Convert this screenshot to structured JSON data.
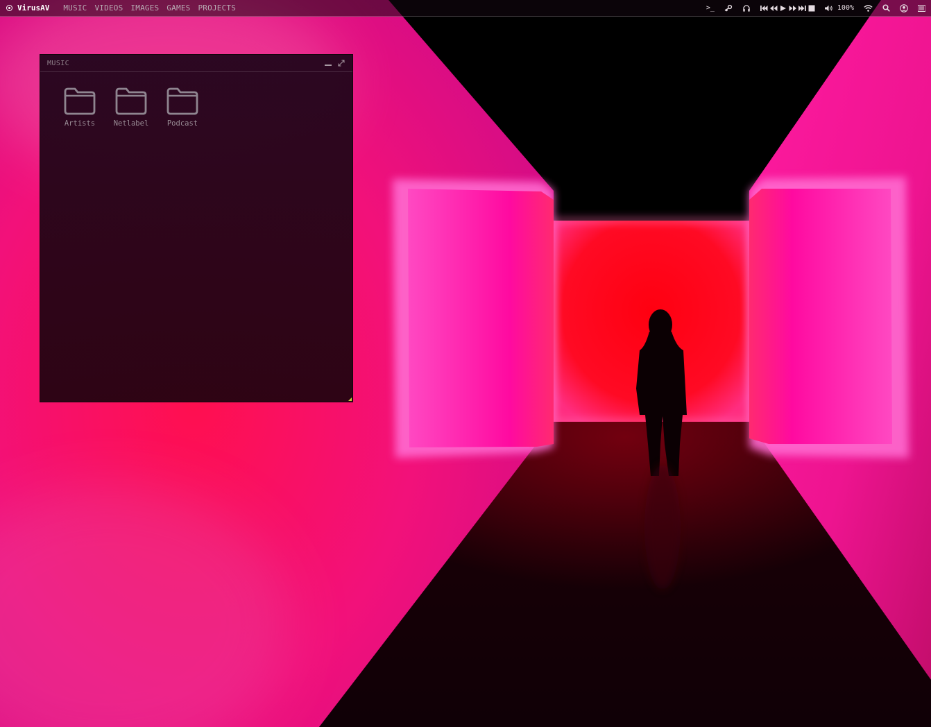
{
  "brand": {
    "name": "VirusAV",
    "icon": "logo-icon"
  },
  "nav": [
    {
      "label": "MUSIC"
    },
    {
      "label": "VIDEOS"
    },
    {
      "label": "IMAGES"
    },
    {
      "label": "GAMES"
    },
    {
      "label": "PROJECTS"
    }
  ],
  "tray": {
    "terminal": ">_",
    "volume_level": "100%",
    "icons": [
      "terminal-icon",
      "steam-icon",
      "headphones-icon",
      "skip-back-icon",
      "rewind-icon",
      "play-icon",
      "fast-forward-icon",
      "skip-forward-icon",
      "stop-icon",
      "volume-icon",
      "wifi-icon",
      "search-icon",
      "user-icon",
      "menu-icon"
    ]
  },
  "music_window": {
    "title": "MUSIC",
    "folders": [
      {
        "label": "Artists"
      },
      {
        "label": "Netlabel"
      },
      {
        "label": "Podcast"
      }
    ]
  },
  "colors": {
    "accent_grip": "#c6d23a",
    "wall_pink": "#ff1a8c",
    "back_red": "#ff0a1e"
  }
}
